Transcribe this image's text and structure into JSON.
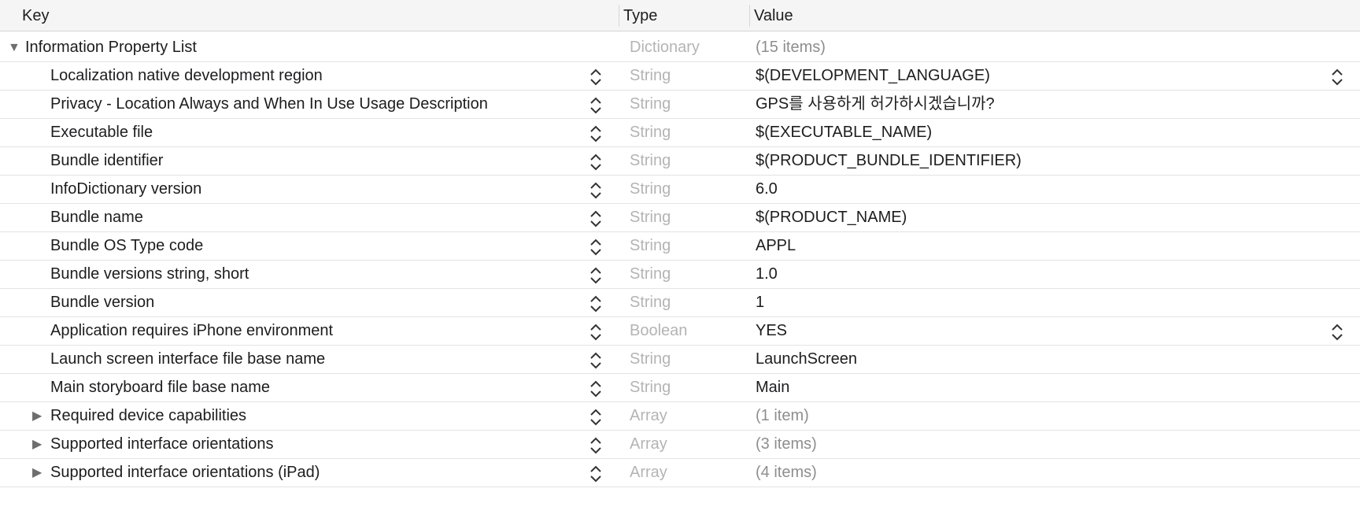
{
  "header": {
    "key_label": "Key",
    "type_label": "Type",
    "value_label": "Value"
  },
  "root": {
    "key": "Information Property List",
    "type": "Dictionary",
    "value": "(15 items)",
    "disclosure_icon": "triangle-down-icon"
  },
  "rows": [
    {
      "key": "Localization native development region",
      "type": "String",
      "value": "$(DEVELOPMENT_LANGUAGE)"
    },
    {
      "key": "Privacy - Location Always and When In Use Usage Description",
      "type": "String",
      "value": "GPS를 사용하게 허가하시겠습니까?"
    },
    {
      "key": "Executable file",
      "type": "String",
      "value": "$(EXECUTABLE_NAME)"
    },
    {
      "key": "Bundle identifier",
      "type": "String",
      "value": "$(PRODUCT_BUNDLE_IDENTIFIER)"
    },
    {
      "key": "InfoDictionary version",
      "type": "String",
      "value": "6.0"
    },
    {
      "key": "Bundle name",
      "type": "String",
      "value": "$(PRODUCT_NAME)"
    },
    {
      "key": "Bundle OS Type code",
      "type": "String",
      "value": "APPL"
    },
    {
      "key": "Bundle versions string, short",
      "type": "String",
      "value": "1.0"
    },
    {
      "key": "Bundle version",
      "type": "String",
      "value": "1"
    },
    {
      "key": "Application requires iPhone environment",
      "type": "Boolean",
      "value": "YES"
    },
    {
      "key": "Launch screen interface file base name",
      "type": "String",
      "value": "LaunchScreen"
    },
    {
      "key": "Main storyboard file base name",
      "type": "String",
      "value": "Main"
    },
    {
      "key": "Required device capabilities",
      "type": "Array",
      "value": "(1 item)"
    },
    {
      "key": "Supported interface orientations",
      "type": "Array",
      "value": "(3 items)"
    },
    {
      "key": "Supported interface orientations (iPad)",
      "type": "Array",
      "value": "(4 items)"
    }
  ],
  "icons": {
    "stepper": "up-down-chevron-icon",
    "collapsed": "triangle-right-icon"
  },
  "colors": {
    "header_bg": "#f5f5f5",
    "type_text": "#b4b4b4",
    "muted_value": "#8e8e8e",
    "separator": "#e3e3e3"
  }
}
